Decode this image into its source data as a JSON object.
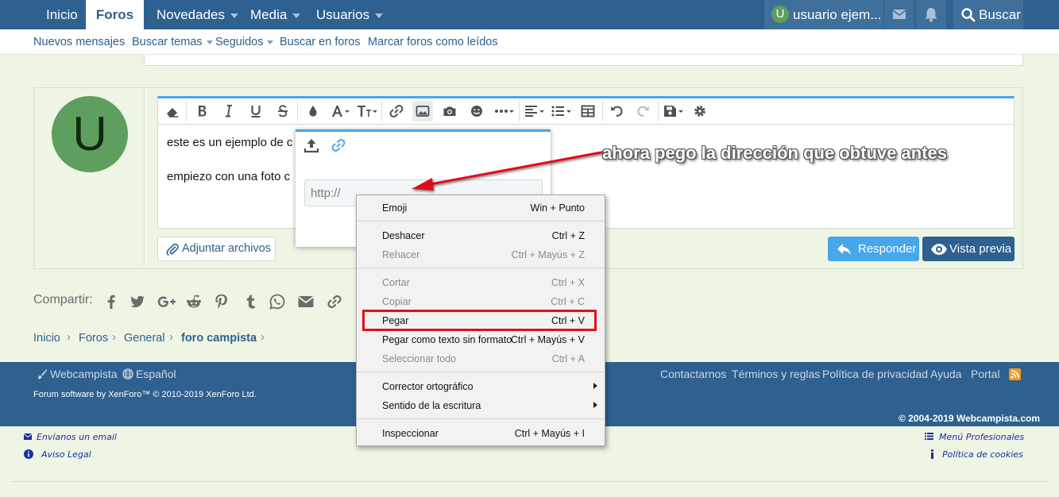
{
  "nav": {
    "tabs": [
      {
        "label": "Inicio"
      },
      {
        "label": "Foros"
      },
      {
        "label": "Novedades"
      },
      {
        "label": "Media"
      },
      {
        "label": "Usuarios"
      }
    ],
    "user_initial": "U",
    "user_name": "usuario ejem...",
    "search_label": "Buscar"
  },
  "subnav": {
    "items": [
      {
        "label": "Nuevos mensajes"
      },
      {
        "label": "Buscar temas"
      },
      {
        "label": "Seguidos"
      },
      {
        "label": "Buscar en foros"
      },
      {
        "label": "Marcar foros como leídos"
      }
    ]
  },
  "post": {
    "avatar_initial": "U",
    "lines": [
      "este es un ejemplo de c",
      "empiezo con una foto c"
    ]
  },
  "popup": {
    "url_placeholder": "http://"
  },
  "buttons": {
    "attach": "Adjuntar archivos",
    "reply": "Responder",
    "preview": "Vista previa"
  },
  "share": {
    "label": "Compartir:"
  },
  "breadcrumb": [
    "Inicio",
    "Foros",
    "General",
    "foro campista"
  ],
  "footer": {
    "style": "Webcampista",
    "language": "Español",
    "links": [
      "Contactarnos",
      "Términos y reglas",
      "Política de privacidad",
      "Ayuda",
      "Portal"
    ],
    "software": "Forum software by XenForo™ © 2010-2019 XenForo Ltd.",
    "site_copyright": "© 2004-2019 Webcampista.com"
  },
  "bottom_links": {
    "email": "Envíanos un email",
    "legal": "Aviso Legal",
    "menu": "Menú Profesionales",
    "cookies": "Política de cookies"
  },
  "context_menu": {
    "items": [
      {
        "label": "Emoji",
        "shortcut": "Win + Punto",
        "disabled": false
      },
      {
        "label": "Deshacer",
        "shortcut": "Ctrl + Z",
        "disabled": false
      },
      {
        "label": "Rehacer",
        "shortcut": "Ctrl + Mayús + Z",
        "disabled": true
      },
      {
        "label": "Cortar",
        "shortcut": "Ctrl + X",
        "disabled": true
      },
      {
        "label": "Copiar",
        "shortcut": "Ctrl + C",
        "disabled": true
      },
      {
        "label": "Pegar",
        "shortcut": "Ctrl + V",
        "disabled": false
      },
      {
        "label": "Pegar como texto sin formato",
        "shortcut": "Ctrl + Mayús + V",
        "disabled": false
      },
      {
        "label": "Seleccionar todo",
        "shortcut": "Ctrl + A",
        "disabled": true
      },
      {
        "label": "Corrector ortográfico",
        "shortcut": "",
        "disabled": false
      },
      {
        "label": "Sentido de la escritura",
        "shortcut": "",
        "disabled": false
      },
      {
        "label": "Inspeccionar",
        "shortcut": "Ctrl + Mayús + I",
        "disabled": false
      }
    ]
  },
  "annotation": "ahora pego la dirección que obtuve antes",
  "colors": {
    "nav": "#2e6090",
    "accent": "#47a7eb",
    "highlight": "#e0101a",
    "page": "#eef5e5"
  }
}
